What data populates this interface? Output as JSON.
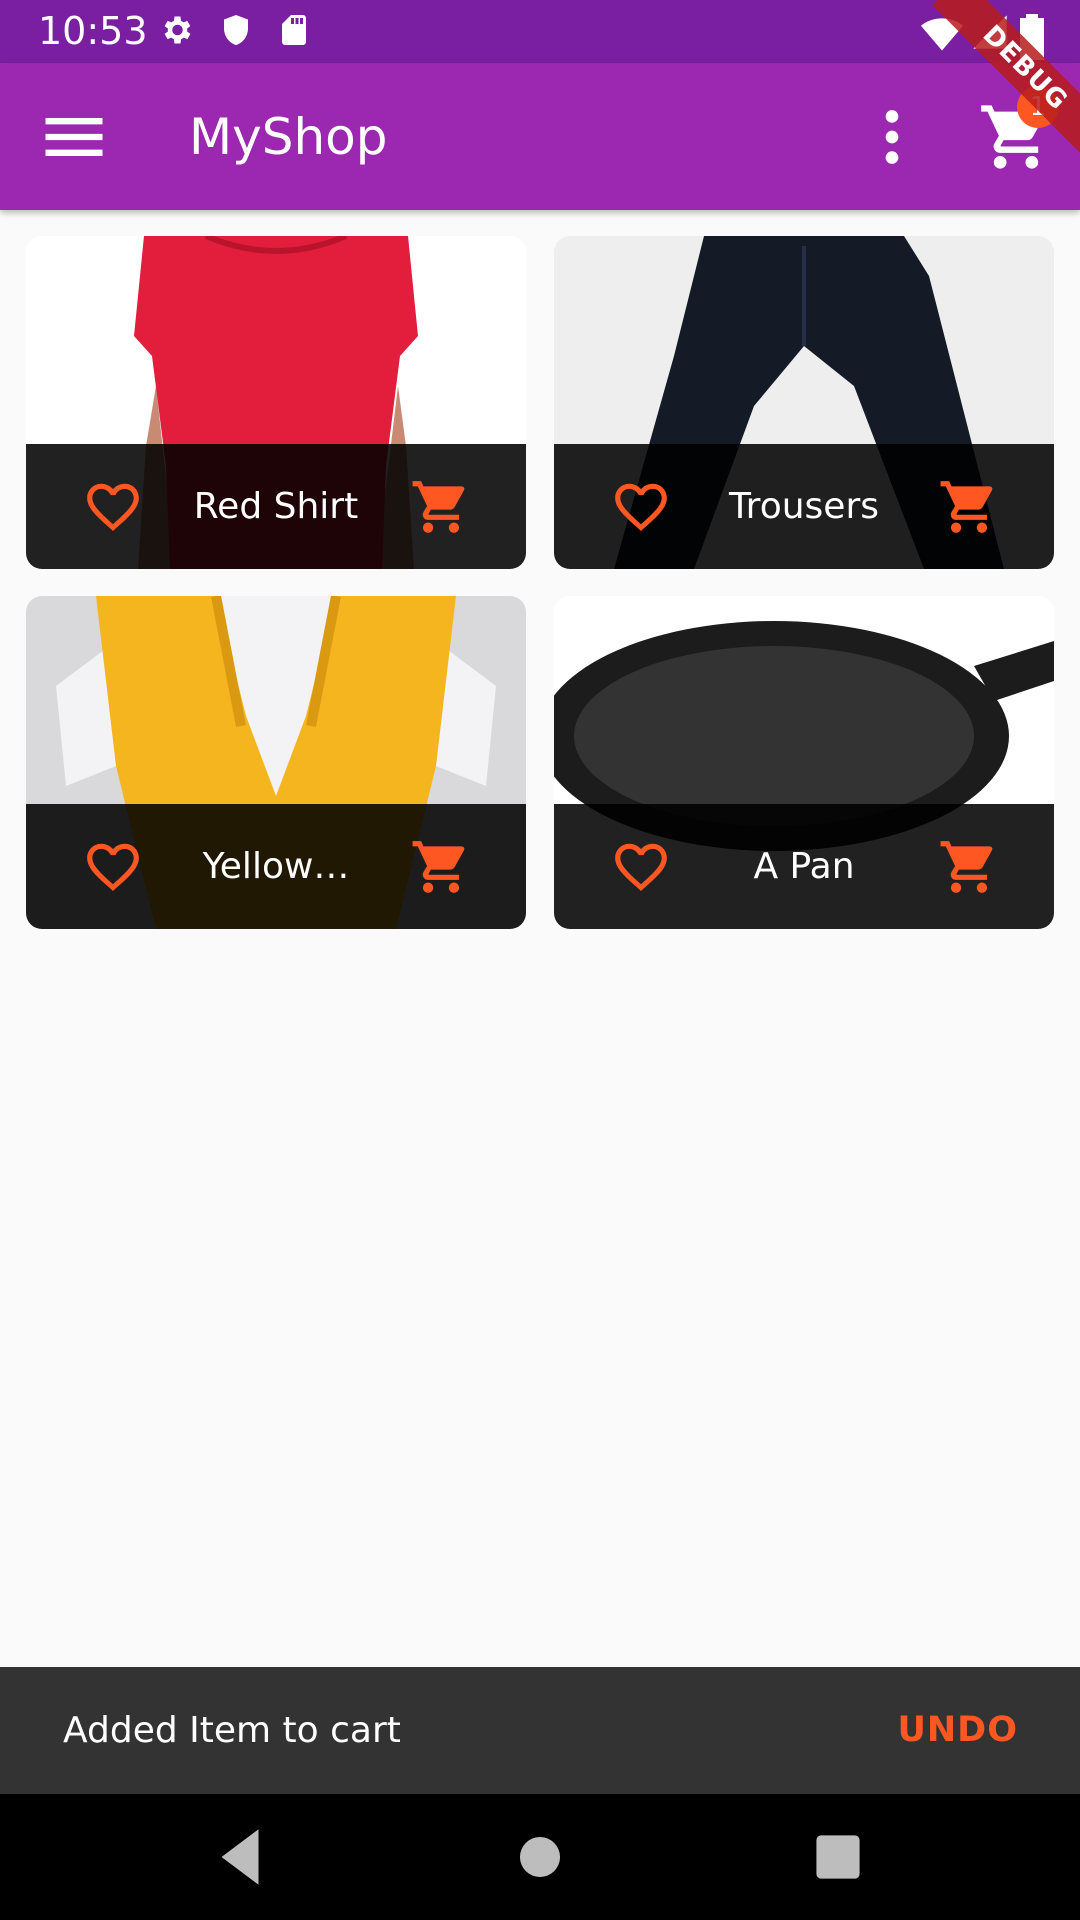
{
  "status_bar": {
    "time": "10:53",
    "icons_left": [
      "gear-icon",
      "shield-icon",
      "sd-card-icon"
    ],
    "icons_right": [
      "wifi-icon",
      "signal-icon",
      "battery-icon"
    ]
  },
  "app_bar": {
    "title": "MyShop",
    "menu_icon": "hamburger-menu-icon",
    "more_icon": "more-vert-icon",
    "cart_icon": "shopping-cart-icon",
    "cart_badge": "1",
    "debug_banner": "DEBUG",
    "color": "#9c27b0",
    "status_color": "#7b1fa2"
  },
  "products": [
    {
      "title": "Red Shirt",
      "image": "red-shirt-image"
    },
    {
      "title": "Trousers",
      "image": "trousers-image"
    },
    {
      "title": "Yellow…",
      "image": "yellow-scarf-image"
    },
    {
      "title": "A Pan",
      "image": "pan-image"
    }
  ],
  "accent_color": "#ff5722",
  "snackbar": {
    "message": "Added Item to cart",
    "action": "UNDO"
  },
  "nav_bar": {
    "back_icon": "back-triangle-icon",
    "home_icon": "home-circle-icon",
    "recents_icon": "recents-square-icon"
  }
}
